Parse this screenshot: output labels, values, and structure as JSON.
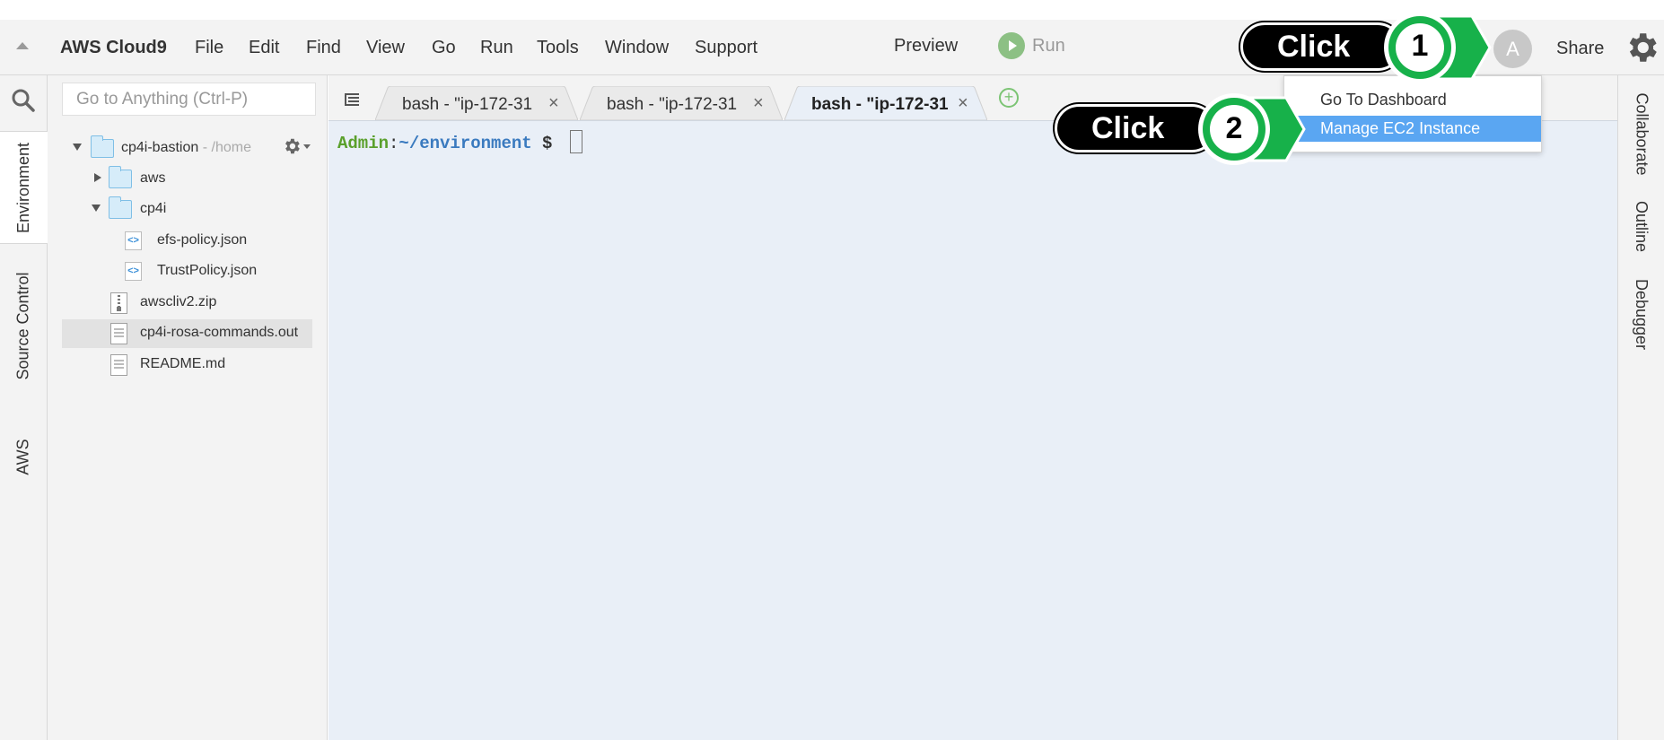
{
  "menubar": {
    "brand": "AWS Cloud9",
    "items": [
      "File",
      "Edit",
      "Find",
      "View",
      "Go",
      "Run",
      "Tools",
      "Window",
      "Support"
    ],
    "preview_label": "Preview",
    "run_label": "Run",
    "avatar_letter": "A",
    "share_label": "Share"
  },
  "left_tabs": [
    "Environment",
    "Source Control",
    "AWS"
  ],
  "right_tabs": [
    "Collaborate",
    "Outline",
    "Debugger"
  ],
  "search": {
    "placeholder": "Go to Anything (Ctrl-P)"
  },
  "tree": {
    "root_name": "cp4i-bastion",
    "root_path": " - /home",
    "items": [
      {
        "name": "aws",
        "type": "folder"
      },
      {
        "name": "cp4i",
        "type": "folder"
      },
      {
        "name": "efs-policy.json",
        "type": "json"
      },
      {
        "name": "TrustPolicy.json",
        "type": "json"
      },
      {
        "name": "awscliv2.zip",
        "type": "zip"
      },
      {
        "name": "cp4i-rosa-commands.out",
        "type": "file"
      },
      {
        "name": "README.md",
        "type": "file"
      }
    ]
  },
  "editor_tabs": [
    {
      "label": "bash - \"ip-172-31",
      "close": "×"
    },
    {
      "label": "bash - \"ip-172-31",
      "close": "×"
    },
    {
      "label": "bash - \"ip-172-31",
      "close": "×"
    }
  ],
  "add_tab_symbol": "+",
  "terminal": {
    "user": "Admin",
    "colon": ":",
    "path": "~/environment",
    "dollar": " $ "
  },
  "dropdown": {
    "items": [
      "Go To Dashboard",
      "Manage EC2 Instance"
    ]
  },
  "annotations": [
    {
      "text": "Click",
      "step": "1"
    },
    {
      "text": "Click",
      "step": "2"
    }
  ],
  "colors": {
    "accent_green": "#17b14a",
    "highlight_blue": "#5aa6f2",
    "terminal_bg": "#e9eff7"
  }
}
